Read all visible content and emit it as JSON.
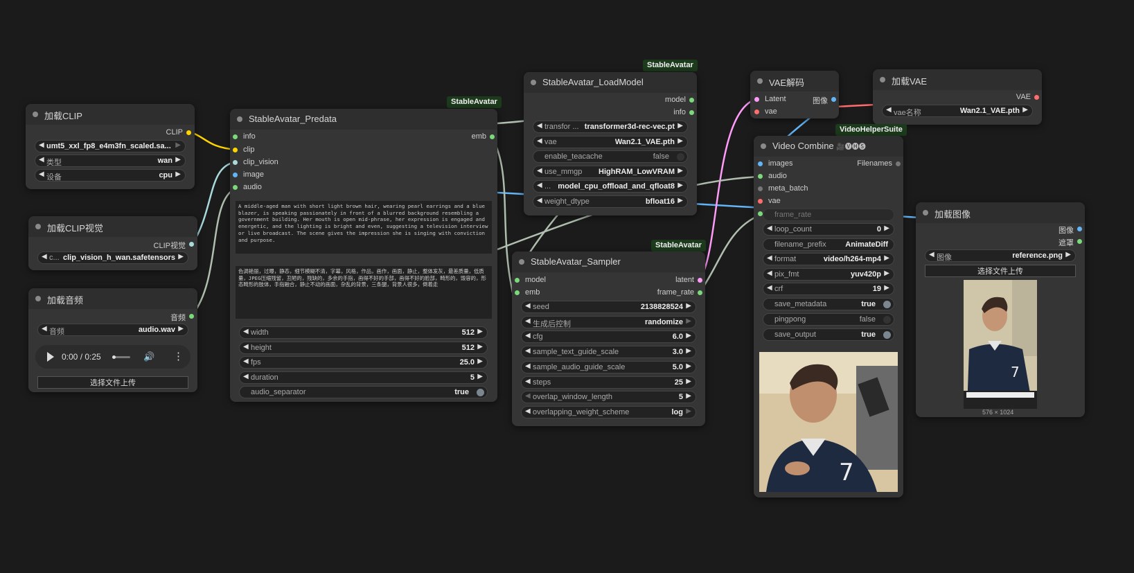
{
  "badges": {
    "stableavatar": "StableAvatar",
    "vhs": "VideoHelperSuite"
  },
  "colors": {
    "canvas": "#1b1b1b",
    "node_body": "#353535",
    "node_title": "#2e2e2e",
    "badge_bg": "#1c3a1c",
    "pin_clip": "#ffd500",
    "pin_model": "#b39ddb",
    "pin_image": "#64b5f6",
    "pin_latent": "#ff9cf9",
    "pin_vae": "#ff6e6e",
    "pin_generic": "#7bd87b",
    "pin_clip_vision": "#a8dadc"
  },
  "load_clip": {
    "title": "加载CLIP",
    "out_clip": "CLIP",
    "clip_name": "umt5_xxl_fp8_e4m3fn_scaled.sa...",
    "type_label": "类型",
    "type_value": "wan",
    "device_label": "设备",
    "device_value": "cpu"
  },
  "load_clip_vision": {
    "title": "加载CLIP视觉",
    "out": "CLIP视觉",
    "name_label": "c...",
    "name_value": "clip_vision_h_wan.safetensors"
  },
  "load_audio": {
    "title": "加载音频",
    "out": "音频",
    "audio_label": "音频",
    "audio_value": "audio.wav",
    "time": "0:00 / 0:25",
    "upload": "选择文件上传"
  },
  "predata": {
    "title": "StableAvatar_Predata",
    "in_info": "info",
    "in_clip": "clip",
    "in_clip_vision": "clip_vision",
    "in_image": "image",
    "in_audio": "audio",
    "out_emb": "emb",
    "prompt": "A middle-aged man with short light brown hair, wearing pearl earrings and a blue blazer, is speaking passionately in front of a blurred background resembling a government building. Her mouth is open mid-phrase, her expression is engaged and energetic, and the lighting is bright and even, suggesting a television interview or live broadcast. The scene gives the impression she is singing with conviction and purpose.",
    "negative": "色调艳丽，过曝，静态，细节模糊不清，字幕，风格，作品，画作，画面，静止，整体发灰，最差质量，低质量，JPEG压缩残留，丑陋的，残缺的，多余的手指，画得不好的手部，画得不好的脸部，畸形的，毁容的，形态畸形的肢体，手指融合，静止不动的画面，杂乱的背景，三条腿，背景人很多，倒着走",
    "width_label": "width",
    "width_value": "512",
    "height_label": "height",
    "height_value": "512",
    "fps_label": "fps",
    "fps_value": "25.0",
    "duration_label": "duration",
    "duration_value": "5",
    "sep_label": "audio_separator",
    "sep_value": "true"
  },
  "load_model": {
    "title": "StableAvatar_LoadModel",
    "out_model": "model",
    "out_info": "info",
    "transformer_label": "transfor ...",
    "transformer_value": "transformer3d-rec-vec.pt",
    "vae_label": "vae",
    "vae_value": "Wan2.1_VAE.pth",
    "teacache_label": "enable_teacache",
    "teacache_value": "false",
    "mmgp_label": "use_mmgp",
    "mmgp_value": "HighRAM_LowVRAM",
    "offload_label": "...",
    "offload_value": "model_cpu_offload_and_qfloat8",
    "dtype_label": "weight_dtype",
    "dtype_value": "bfloat16"
  },
  "sampler": {
    "title": "StableAvatar_Sampler",
    "in_model": "model",
    "in_emb": "emb",
    "out_latent": "latent",
    "out_frame_rate": "frame_rate",
    "seed_label": "seed",
    "seed_value": "2138828524",
    "ctrl_label": "生成后控制",
    "ctrl_value": "randomize",
    "cfg_label": "cfg",
    "cfg_value": "6.0",
    "text_label": "sample_text_guide_scale",
    "text_value": "3.0",
    "audio_label": "sample_audio_guide_scale",
    "audio_value": "5.0",
    "steps_label": "steps",
    "steps_value": "25",
    "overlap_label": "overlap_window_length",
    "overlap_value": "5",
    "scheme_label": "overlapping_weight_scheme",
    "scheme_value": "log"
  },
  "vae_decode": {
    "title": "VAE解码",
    "in_latent": "Latent",
    "in_vae": "vae",
    "out_image": "图像"
  },
  "load_vae": {
    "title": "加载VAE",
    "out": "VAE",
    "name_label": "vae名称",
    "name_value": "Wan2.1_VAE.pth"
  },
  "video_combine": {
    "title": "Video Combine",
    "title_icons": "🎥🅥🅗🅢",
    "in_images": "images",
    "in_audio": "audio",
    "in_meta": "meta_batch",
    "in_vae": "vae",
    "out_filenames": "Filenames",
    "frame_rate_label": "frame_rate",
    "loop_label": "loop_count",
    "loop_value": "0",
    "prefix_label": "filename_prefix",
    "prefix_value": "AnimateDiff",
    "format_label": "format",
    "format_value": "video/h264-mp4",
    "pix_label": "pix_fmt",
    "pix_value": "yuv420p",
    "crf_label": "crf",
    "crf_value": "19",
    "meta_label": "save_metadata",
    "meta_value": "true",
    "ping_label": "pingpong",
    "ping_value": "false",
    "save_label": "save_output",
    "save_value": "true"
  },
  "load_image": {
    "title": "加载图像",
    "out_image": "图像",
    "out_mask": "遮罩",
    "image_label": "图像",
    "image_value": "reference.png",
    "upload": "选择文件上传",
    "size": "576 × 1024"
  }
}
